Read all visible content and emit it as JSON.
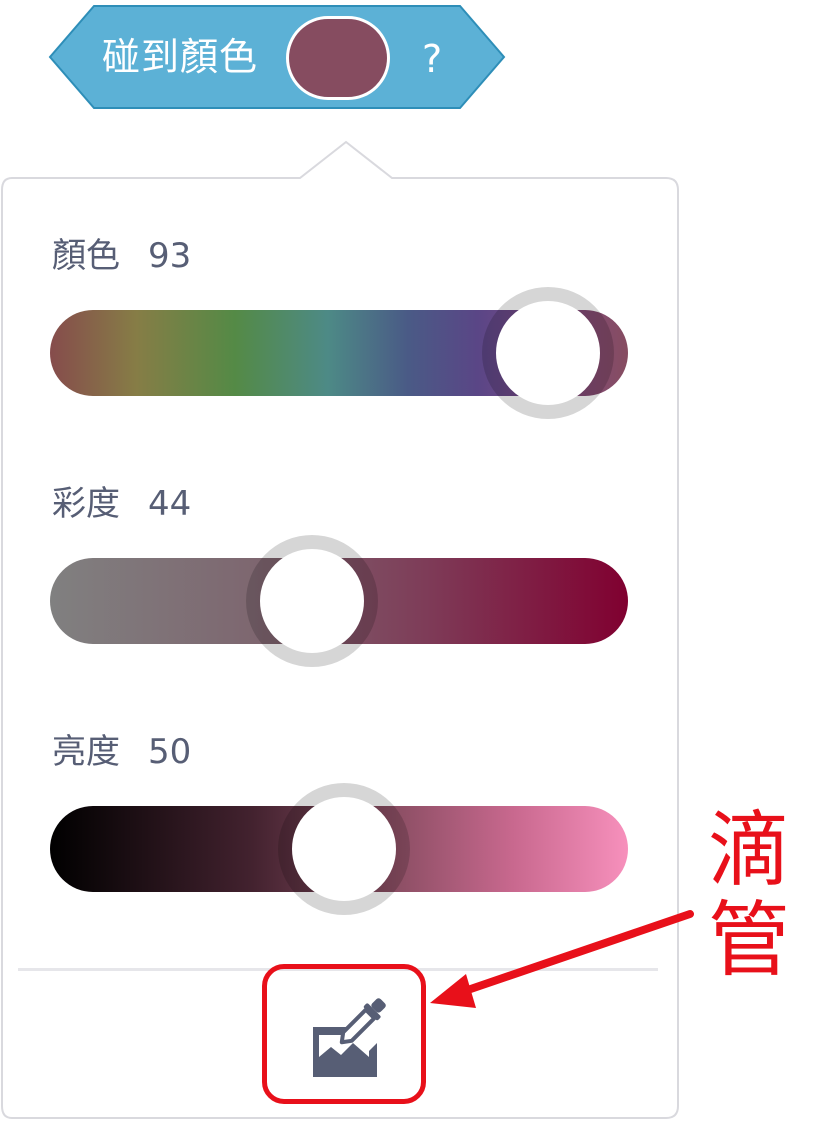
{
  "block": {
    "label": "碰到顏色",
    "question": "?",
    "swatch_color": "#864c60",
    "block_color": "#5cb1d6",
    "block_border": "#2e8eb8"
  },
  "popup": {
    "sliders": [
      {
        "name": "hue",
        "label": "顏色",
        "value": "93",
        "level": 0.93
      },
      {
        "name": "saturation",
        "label": "彩度",
        "value": "44",
        "level": 0.44
      },
      {
        "name": "brightness",
        "label": "亮度",
        "value": "50",
        "level": 0.5
      }
    ],
    "eyedropper_icon": "eyedropper-icon"
  },
  "annotation": {
    "line1": "滴",
    "line2": "管",
    "color": "#e8101a"
  }
}
